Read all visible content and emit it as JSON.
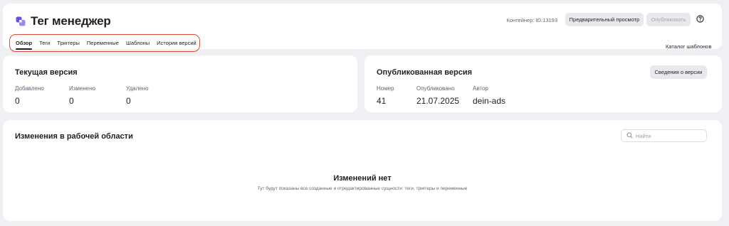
{
  "header": {
    "app_title": "Тег менеджер",
    "container_id": "Контейнер: ID:13193",
    "preview_label": "Предварительный просмотр",
    "publish_label": "Опубликовать",
    "help_icon": "question-circle-icon",
    "tabs": [
      {
        "label": "Обзор",
        "active": true
      },
      {
        "label": "Теги",
        "active": false
      },
      {
        "label": "Триггеры",
        "active": false
      },
      {
        "label": "Переменные",
        "active": false
      },
      {
        "label": "Шаблоны",
        "active": false
      },
      {
        "label": "История версий",
        "active": false
      }
    ],
    "catalog_label": "Каталог шаблонов",
    "accent_color": "#6b4fe0",
    "highlight_color": "#e04a3a"
  },
  "current_version": {
    "title": "Текущая версия",
    "stats": [
      {
        "label": "Добавлено",
        "value": "0"
      },
      {
        "label": "Изменено",
        "value": "0"
      },
      {
        "label": "Удалено",
        "value": "0"
      }
    ]
  },
  "published_version": {
    "title": "Опубликованная версия",
    "details_label": "Сведения о версии",
    "stats": [
      {
        "label": "Номер",
        "value": "41"
      },
      {
        "label": "Опубликовано",
        "value": "21.07.2025"
      },
      {
        "label": "Автор",
        "value": "dein-ads"
      }
    ]
  },
  "changes": {
    "title": "Изменения в рабочей области",
    "search_placeholder": "Найти",
    "search_icon": "search-icon",
    "empty_title": "Изменений нет",
    "empty_description": "Тут будут показаны все созданные и отредактированные сущности: теги, триггеры и переменные"
  }
}
